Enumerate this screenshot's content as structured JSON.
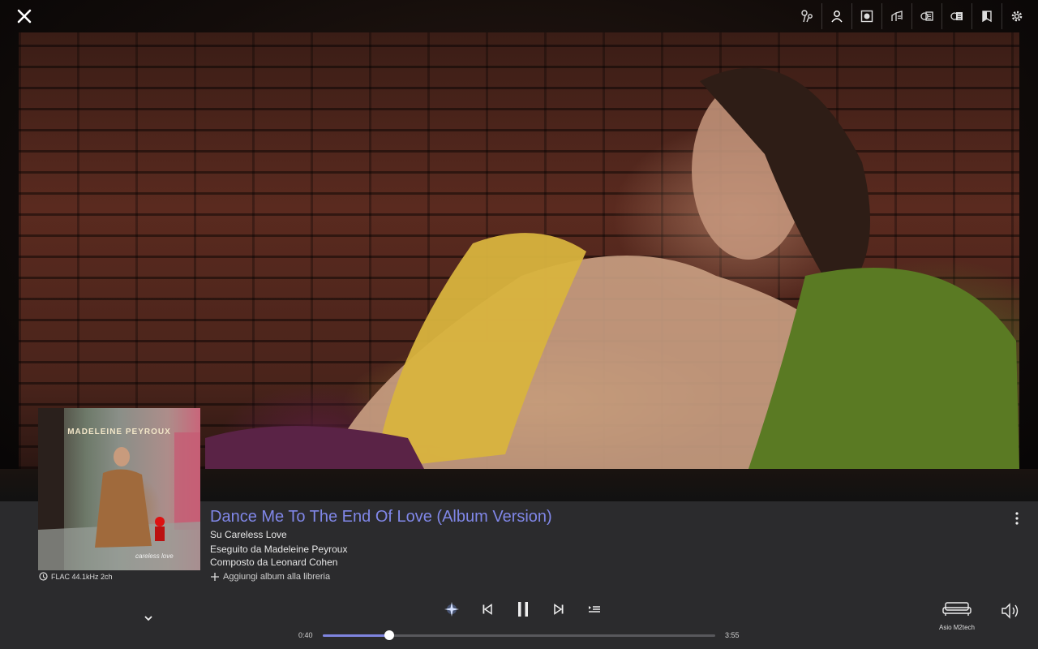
{
  "window": {
    "close_icon": "close-icon"
  },
  "toolbar": {
    "icons": [
      "artist-connections-icon",
      "artist-icon",
      "album-icon",
      "lyrics-icon",
      "review-icon",
      "credits-icon",
      "bookmark-icon",
      "settings-icon"
    ]
  },
  "hero": {
    "image": "artist-photo"
  },
  "album": {
    "cover_title": "MADELEINE PEYROUX",
    "cover_subtitle": "careless love",
    "quality": "FLAC 44.1kHz 2ch"
  },
  "track": {
    "title": "Dance Me To The End Of Love (Album Version)",
    "on_prefix": "Su ",
    "on_value": "Careless Love",
    "performed_prefix": "Eseguito da ",
    "performed_value": "Madeleine Peyroux",
    "composed_prefix": "Composto da ",
    "composed_value": "Leonard Cohen",
    "add_library": "Aggiungi album alla libreria"
  },
  "player": {
    "elapsed": "0:40",
    "duration": "3:55",
    "progress": 0.17,
    "state": "playing"
  },
  "output": {
    "device": "Asio M2tech"
  },
  "colors": {
    "accent": "#8087e8",
    "panel": "#2b2b2d",
    "progress_fill": "#7f85e0"
  }
}
